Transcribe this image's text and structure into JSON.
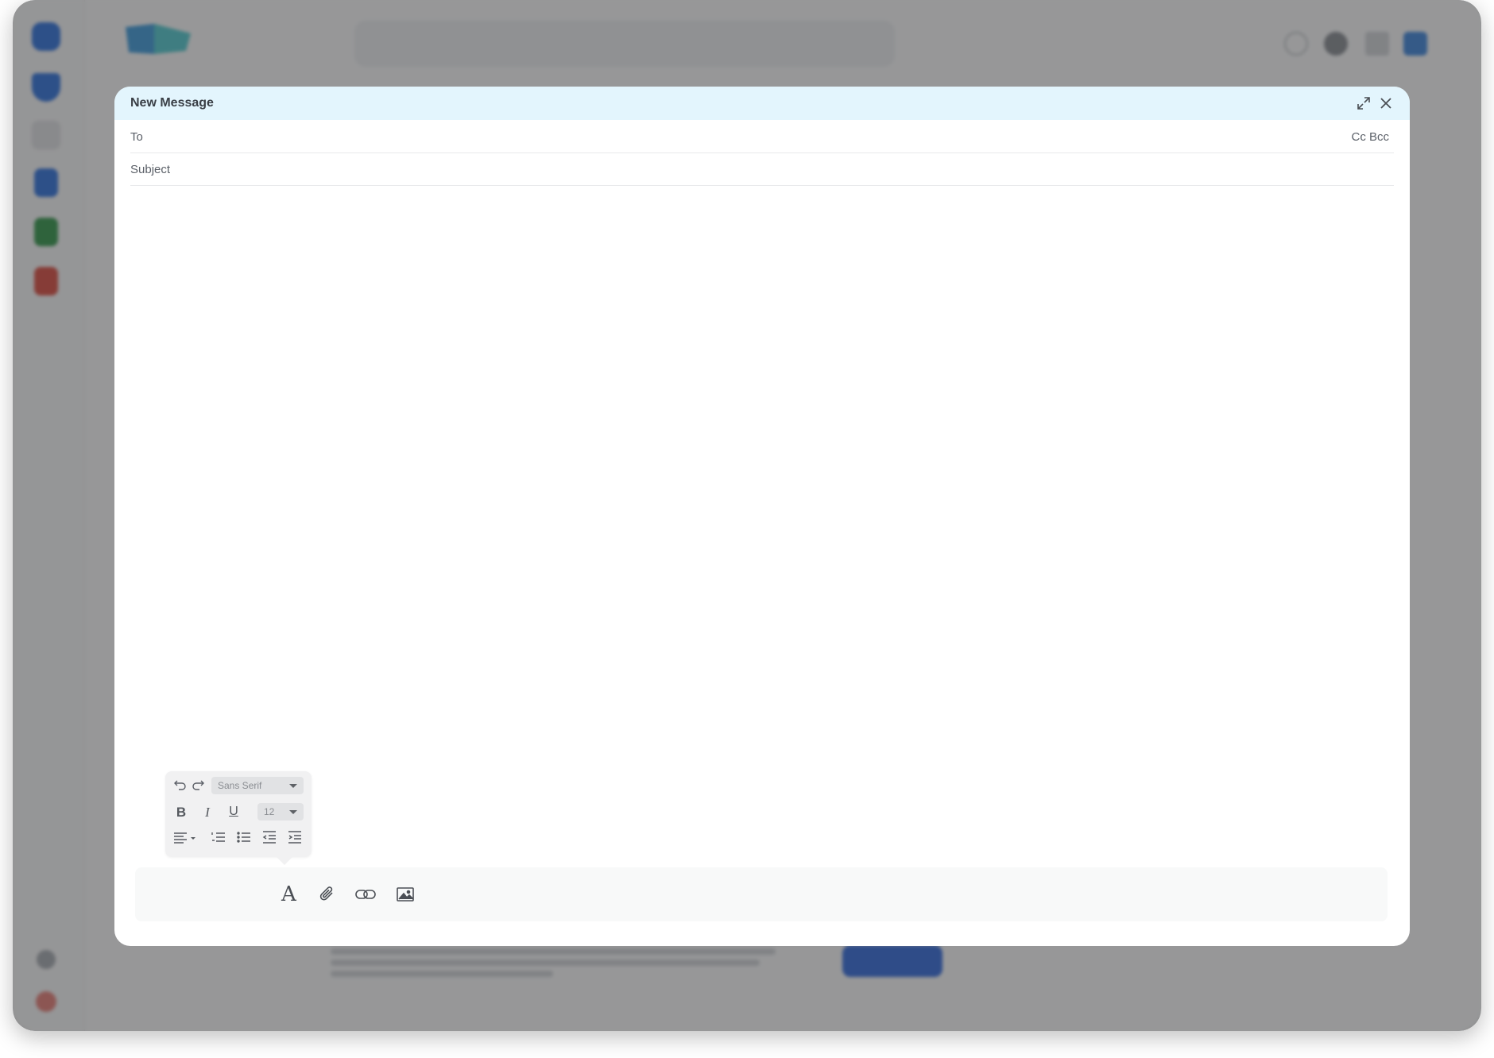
{
  "compose": {
    "title": "New Message",
    "to_label": "To",
    "to_value": "",
    "cc_bcc_label": "Cc Bcc",
    "subject_label": "Subject",
    "subject_value": "",
    "body_value": ""
  },
  "format_popup": {
    "font_family": "Sans Serif",
    "font_size": "12"
  },
  "icons": {
    "header": [
      "expand-icon",
      "close-icon"
    ],
    "format": [
      "undo-icon",
      "redo-icon",
      "bold-icon",
      "italic-icon",
      "underline-icon",
      "align-left-icon",
      "numbered-list-icon",
      "bulleted-list-icon",
      "indent-decrease-icon",
      "indent-increase-icon"
    ],
    "bottom_toolbar": [
      "text-format-icon",
      "attachment-icon",
      "link-icon",
      "image-icon"
    ]
  },
  "colors": {
    "header_bg": "#e3f5fd",
    "overlay": "#404040",
    "accent": "#1e5bd8"
  }
}
